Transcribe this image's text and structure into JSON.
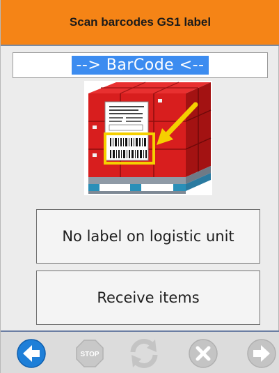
{
  "header": {
    "title": "Scan barcodes GS1 label"
  },
  "barcode_input": {
    "value": "--> BarCode <--"
  },
  "buttons": {
    "no_label": "No label on logistic unit",
    "receive_items": "Receive items"
  },
  "toolbar": {
    "stop_label": "STOP",
    "icons": [
      "back-arrow-icon",
      "stop-icon",
      "refresh-icon",
      "cancel-icon",
      "forward-arrow-icon"
    ]
  },
  "colors": {
    "header_bg": "#f58416",
    "accent_blue": "#1e7fd8",
    "selection_blue": "#3c8cf0",
    "disabled_gray": "#c4c4c4",
    "pallet_red": "#dc1c1c"
  }
}
